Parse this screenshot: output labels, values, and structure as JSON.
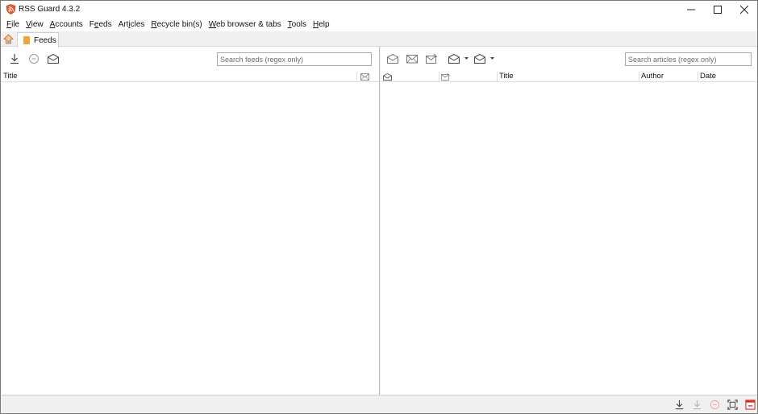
{
  "window": {
    "title": "RSS Guard 4.3.2"
  },
  "menu": {
    "items": [
      {
        "pre": "",
        "key": "F",
        "post": "ile"
      },
      {
        "pre": "",
        "key": "V",
        "post": "iew"
      },
      {
        "pre": "",
        "key": "A",
        "post": "ccounts"
      },
      {
        "pre": "F",
        "key": "e",
        "post": "eds"
      },
      {
        "pre": "Art",
        "key": "i",
        "post": "cles"
      },
      {
        "pre": "",
        "key": "R",
        "post": "ecycle bin(s)"
      },
      {
        "pre": "",
        "key": "W",
        "post": "eb browser & tabs"
      },
      {
        "pre": "",
        "key": "T",
        "post": "ools"
      },
      {
        "pre": "",
        "key": "H",
        "post": "elp"
      }
    ]
  },
  "tabs": {
    "feeds_label": "Feeds"
  },
  "feeds": {
    "search_placeholder": "Search feeds (regex only)",
    "header_title": "Title"
  },
  "articles": {
    "search_placeholder": "Search articles (regex only)",
    "header_title": "Title",
    "header_author": "Author",
    "header_date": "Date"
  },
  "colors": {
    "accent": "#e05a33",
    "tab_icon": "#f2a33a",
    "status_red": "#d9302c",
    "icon_gray": "#555555"
  }
}
